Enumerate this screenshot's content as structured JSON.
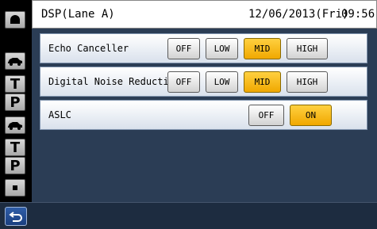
{
  "header": {
    "title": "DSP(Lane A)",
    "date": "12/06/2013(Fri)",
    "time": "09:56"
  },
  "sidebar": {
    "items": [
      {
        "icon": "camera-dome-icon"
      },
      {
        "icon": "car-icon"
      },
      {
        "label": "T"
      },
      {
        "label": "P"
      },
      {
        "icon": "car-icon"
      },
      {
        "label": "T"
      },
      {
        "label": "P"
      },
      {
        "icon": "dot-icon"
      }
    ]
  },
  "settings": [
    {
      "label": "Echo Canceller",
      "options": [
        "OFF",
        "LOW",
        "MID",
        "HIGH"
      ],
      "selected": "MID"
    },
    {
      "label": "Digital Noise Reduction",
      "options": [
        "OFF",
        "LOW",
        "MID",
        "HIGH"
      ],
      "selected": "MID"
    },
    {
      "label": "ASLC",
      "options": [
        "OFF",
        "ON"
      ],
      "selected": "ON"
    }
  ],
  "footer": {
    "back_icon": "return-arrow-icon"
  },
  "colors": {
    "selected": "#f0a800",
    "panel": "#2b3d55"
  }
}
